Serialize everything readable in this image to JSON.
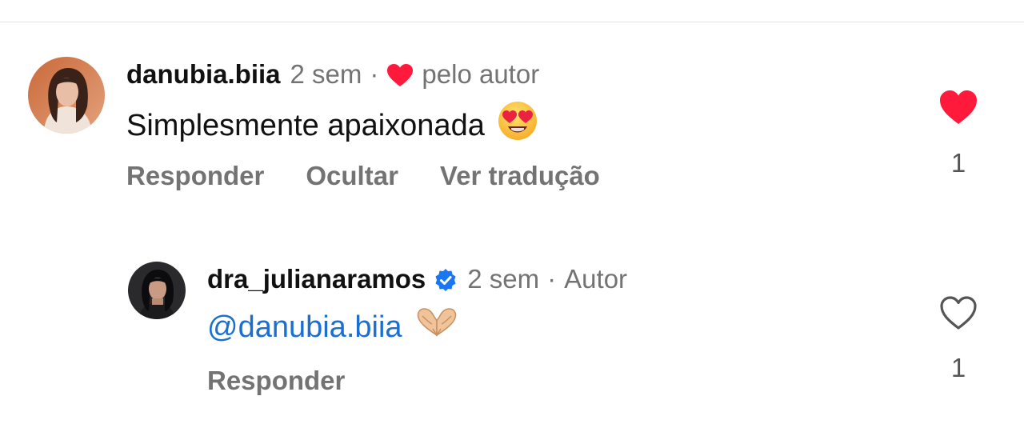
{
  "comments": [
    {
      "username": "danubia.biia",
      "time": "2 sem",
      "separator": "·",
      "liked_by_author_label": "pelo autor",
      "text": "Simplesmente apaixonada",
      "emoji": "heart-eyes",
      "actions": [
        "Responder",
        "Ocultar",
        "Ver tradução"
      ],
      "liked": true,
      "like_count": "1",
      "avatar": "profile-photo-woman-light-hair",
      "accent_color": "#ff3040"
    },
    {
      "username": "dra_julianaramos",
      "verified": true,
      "time": "2 sem",
      "separator": "·",
      "author_badge": "Autor",
      "mention": "@danubia.biia",
      "emoji": "heart-hands",
      "actions": [
        "Responder"
      ],
      "liked": false,
      "like_count": "1",
      "avatar": "profile-photo-woman-dark-hair",
      "verified_color": "#1a77f2"
    }
  ],
  "colors": {
    "text": "#111111",
    "muted": "#737373",
    "link": "#1a6fd1",
    "like": "#ff3040"
  }
}
